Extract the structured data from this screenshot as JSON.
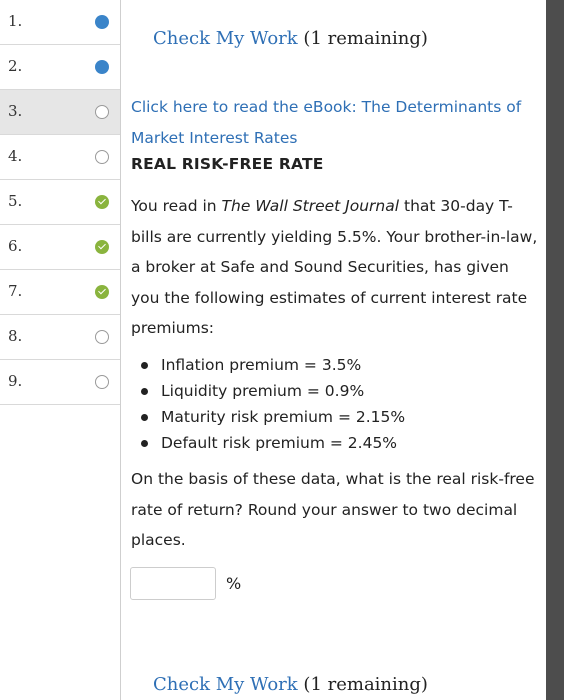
{
  "sidebar": {
    "questions": [
      {
        "number": "1.",
        "status": "answered"
      },
      {
        "number": "2.",
        "status": "answered"
      },
      {
        "number": "3.",
        "status": "empty"
      },
      {
        "number": "4.",
        "status": "empty"
      },
      {
        "number": "5.",
        "status": "correct"
      },
      {
        "number": "6.",
        "status": "correct"
      },
      {
        "number": "7.",
        "status": "correct"
      },
      {
        "number": "8.",
        "status": "empty"
      },
      {
        "number": "9.",
        "status": "empty"
      }
    ],
    "active_index": 2
  },
  "check_top": {
    "link": "Check My Work",
    "remaining": "(1 remaining)"
  },
  "ebook": {
    "label": "Click here to read the eBook: The Determinants of Market Interest Rates"
  },
  "question": {
    "heading": "REAL RISK-FREE RATE",
    "intro_before": "You read in ",
    "intro_italic": "The Wall Street Journal",
    "intro_after": " that 30-day T-bills are currently yielding 5.5%. Your brother-in-law, a broker at Safe and Sound Securities, has given you the following estimates of current interest rate premiums:",
    "bullets": [
      "Inflation premium = 3.5%",
      "Liquidity premium = 0.9%",
      "Maturity risk premium = 2.15%",
      "Default risk premium = 2.45%"
    ],
    "prompt": "On the basis of these data, what is the real risk-free rate of return? Round your answer to two decimal places.",
    "answer_value": "",
    "unit": "%"
  },
  "check_bottom": {
    "link": "Check My Work",
    "remaining": "(1 remaining)"
  },
  "colors": {
    "link": "#2e6fb5",
    "answered": "#3a84c9",
    "correct": "#8ab43e",
    "scrollbar": "#4d4d4d"
  }
}
